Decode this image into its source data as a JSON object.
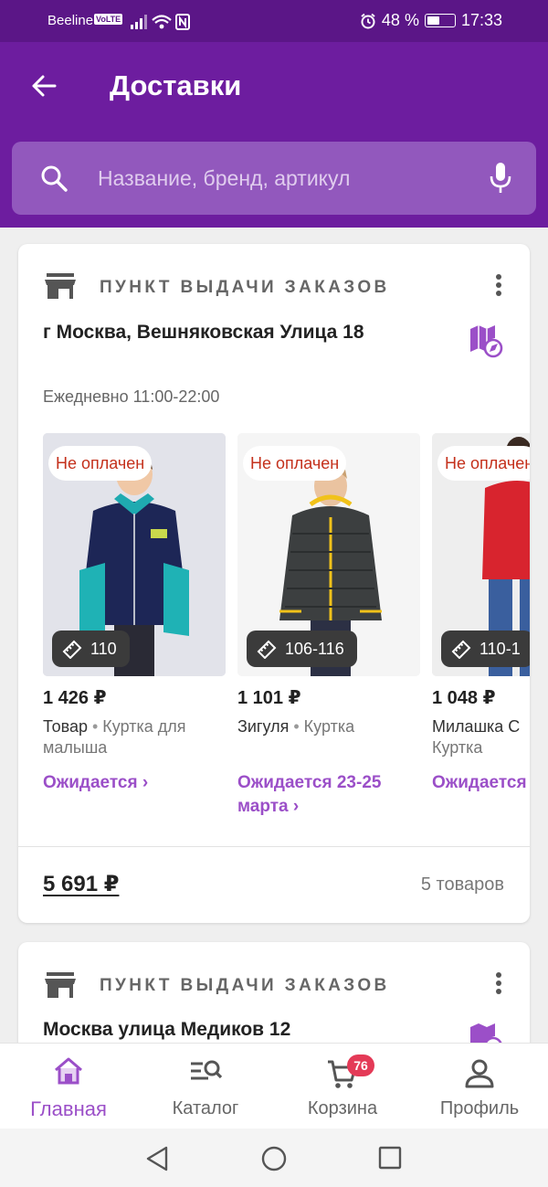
{
  "status_bar": {
    "carrier": "Beeline",
    "volte": "VoLTE",
    "battery": "48 %",
    "battery_level_fraction": 0.48,
    "time": "17:33"
  },
  "header": {
    "title": "Доставки",
    "search_placeholder": "Название, бренд, артикул"
  },
  "deliveries": [
    {
      "type_label": "ПУНКТ ВЫДАЧИ ЗАКАЗОВ",
      "address": "г Москва, Вешняковская Улица 18",
      "hours": "Ежедневно 11:00-22:00",
      "products": [
        {
          "status": "Не оплачен",
          "size": "110",
          "price": "1 426 ₽",
          "brand": "Товар",
          "name": "Куртка для малыша",
          "eta": "Ожидается  ›"
        },
        {
          "status": "Не оплачен",
          "size": "106-116",
          "price": "1 101 ₽",
          "brand": "Зигуля",
          "name": "Куртка",
          "eta": "Ожидается 23-25 марта ›"
        },
        {
          "status": "Не оплачен",
          "size": "110-1",
          "price": "1 048 ₽",
          "brand": "Милашка С",
          "name": "Куртка",
          "eta": "Ожидается марта ›"
        }
      ],
      "total": "5 691 ₽",
      "count": "5 товаров"
    },
    {
      "type_label": "ПУНКТ ВЫДАЧИ ЗАКАЗОВ",
      "address": "Москва  улица Медиков 12"
    }
  ],
  "bottom_nav": {
    "home": "Главная",
    "catalog": "Каталог",
    "cart": "Корзина",
    "cart_count": "76",
    "profile": "Профиль"
  },
  "colors": {
    "status_bar": "#5b1687",
    "app_bar": "#6d1d9f",
    "search_bg": "#9258bd",
    "accent": "#9b4fc8",
    "unpaid_text": "#c4311c",
    "cart_badge": "#e43a57"
  }
}
